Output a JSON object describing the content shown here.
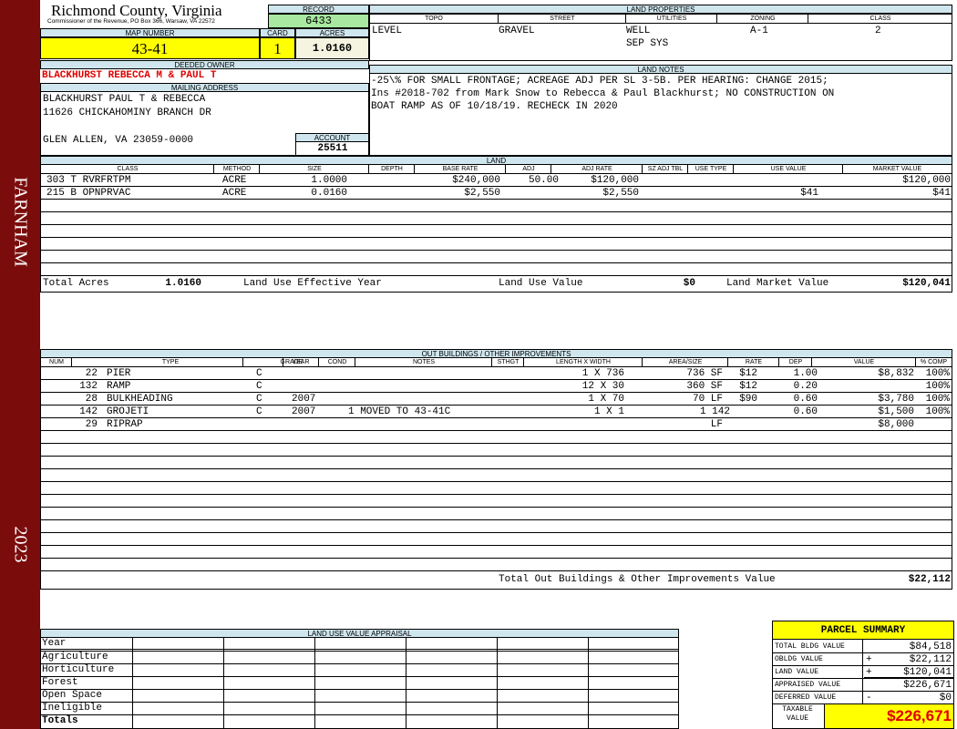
{
  "sidebar": {
    "district": "FARNHAM",
    "year": "2023",
    "color": "#7a0c0c"
  },
  "header": {
    "county": "Richmond County, Virginia",
    "commissioner": "Commissioner of the Revenue, PO Box 366, Warsaw, VA 22572",
    "record_label": "RECORD",
    "record": "6433",
    "map_label": "MAP NUMBER",
    "map_number": "43-41",
    "card_label": "CARD",
    "card": "1",
    "acres_label": "ACRES",
    "acres": "1.0160"
  },
  "owner": {
    "deeded_label": "DEEDED OWNER",
    "deeded_owner": "BLACKHURST REBECCA M & PAUL T",
    "mailing_label": "MAILING ADDRESS",
    "mailing_lines": [
      "BLACKHURST PAUL T & REBECCA",
      "11626 CHICKAHOMINY BRANCH DR",
      "",
      "GLEN ALLEN, VA 23059-0000"
    ],
    "account_label": "ACCOUNT",
    "account": "25511"
  },
  "land_properties": {
    "title": "LAND PROPERTIES",
    "headers": [
      "TOPO",
      "STREET",
      "UTILITIES",
      "ZONING",
      "CLASS"
    ],
    "topo": "LEVEL",
    "street": "GRAVEL",
    "utilities": [
      "WELL",
      "SEP SYS"
    ],
    "zoning": "A-1",
    "class": "2"
  },
  "land_notes": {
    "title": "LAND NOTES",
    "lines": [
      "-25\\% FOR SMALL FRONTAGE; ACREAGE ADJ PER SL 3-5B. PER HEARING: CHANGE 2015;",
      "Ins #2018-702 from Mark Snow to Rebecca & Paul Blackhurst; NO CONSTRUCTION ON",
      "BOAT RAMP AS OF 10/18/19. RECHECK IN 2020"
    ]
  },
  "land": {
    "title": "LAND",
    "headers": [
      "CLASS",
      "METHOD",
      "SIZE",
      "DEPTH",
      "BASE RATE",
      "ADJ",
      "ADJ RATE",
      "SZ ADJ TBL",
      "USE TYPE",
      "USE VALUE",
      "MARKET VALUE"
    ],
    "rows": [
      {
        "class": "303 T RVRFRTPM",
        "method": "ACRE",
        "size": "1.0000",
        "depth": "",
        "base_rate": "$240,000",
        "adj": "50.00",
        "adj_rate": "$120,000",
        "sz_adj": "",
        "use_type": "",
        "use_value": "",
        "market_value": "$120,000"
      },
      {
        "class": "215 B OPNPRVAC",
        "method": "ACRE",
        "size": "0.0160",
        "depth": "",
        "base_rate": "$2,550",
        "adj": "",
        "adj_rate": "$2,550",
        "sz_adj": "",
        "use_type": "",
        "use_value": "$41",
        "market_value": "$41"
      }
    ],
    "total_acres_label": "Total Acres",
    "total_acres": "1.0160",
    "effective_year_label": "Land Use Effective Year",
    "use_value_label": "Land Use Value",
    "use_value": "$0",
    "market_value_label": "Land Market Value",
    "market_value": "$120,041"
  },
  "outbuildings": {
    "title": "OUT BUILDINGS / OTHER IMPROVEMENTS",
    "headers": [
      "NUM",
      "TYPE",
      "GRADE",
      "YEAR",
      "COND",
      "NOTES",
      "STHGT",
      "LENGTH X WIDTH",
      "AREA/SIZE",
      "RATE",
      "DEP",
      "VALUE",
      "% COMP"
    ],
    "rows": [
      {
        "num": "22",
        "type": "PIER",
        "grade": "C",
        "year": "",
        "cond": "",
        "notes": "",
        "sthgt": "",
        "lxw": "1 X 736",
        "area": "736 SF",
        "rate": "$12",
        "dep": "1.00",
        "value": "$8,832",
        "comp": "100%"
      },
      {
        "num": "132",
        "type": "RAMP",
        "grade": "C",
        "year": "",
        "cond": "",
        "notes": "",
        "sthgt": "",
        "lxw": "12 X 30",
        "area": "360 SF",
        "rate": "$12",
        "dep": "0.20",
        "value": "",
        "comp": "100%"
      },
      {
        "num": "28",
        "type": "BULKHEADING",
        "grade": "C",
        "year": "2007",
        "cond": "",
        "notes": "",
        "sthgt": "",
        "lxw": "1 X 70",
        "area": "70 LF",
        "rate": "$90",
        "dep": "0.60",
        "value": "$3,780",
        "comp": "100%"
      },
      {
        "num": "142",
        "type": "GROJETI",
        "grade": "C",
        "year": "2007",
        "cond": "",
        "notes": "1 MOVED TO 43-41C",
        "sthgt": "",
        "lxw": "1 X 1",
        "area": "1 142",
        "rate": "",
        "dep": "0.60",
        "value": "$1,500",
        "comp": "100%"
      },
      {
        "num": "29",
        "type": "RIPRAP",
        "grade": "",
        "year": "",
        "cond": "",
        "notes": "",
        "sthgt": "",
        "lxw": "",
        "area": "LF",
        "rate": "",
        "dep": "",
        "value": "$8,000",
        "comp": ""
      }
    ],
    "total_label": "Total Out Buildings & Other Improvements Value",
    "total": "$22,112"
  },
  "land_use_appraisal": {
    "title": "LAND USE VALUE APPRAISAL",
    "rows": [
      "Year",
      "Agriculture",
      "Horticulture",
      "Forest",
      "Open Space",
      "Ineligible",
      "Totals"
    ]
  },
  "parcel_summary": {
    "title": "PARCEL SUMMARY",
    "rows": [
      {
        "label": "TOTAL BLDG VALUE",
        "op": "",
        "value": "$84,518"
      },
      {
        "label": "OBLDG VALUE",
        "op": "+",
        "value": "$22,112"
      },
      {
        "label": "LAND VALUE",
        "op": "+",
        "value": "$120,041"
      },
      {
        "label": "APPRAISED VALUE",
        "op": "",
        "value": "$226,671"
      },
      {
        "label": "DEFERRED VALUE",
        "op": "-",
        "value": "$0"
      }
    ],
    "taxable_label": "TAXABLE VALUE",
    "taxable": "$226,671",
    "highlight_color": "#ffff00",
    "taxable_color": "#e00000"
  }
}
